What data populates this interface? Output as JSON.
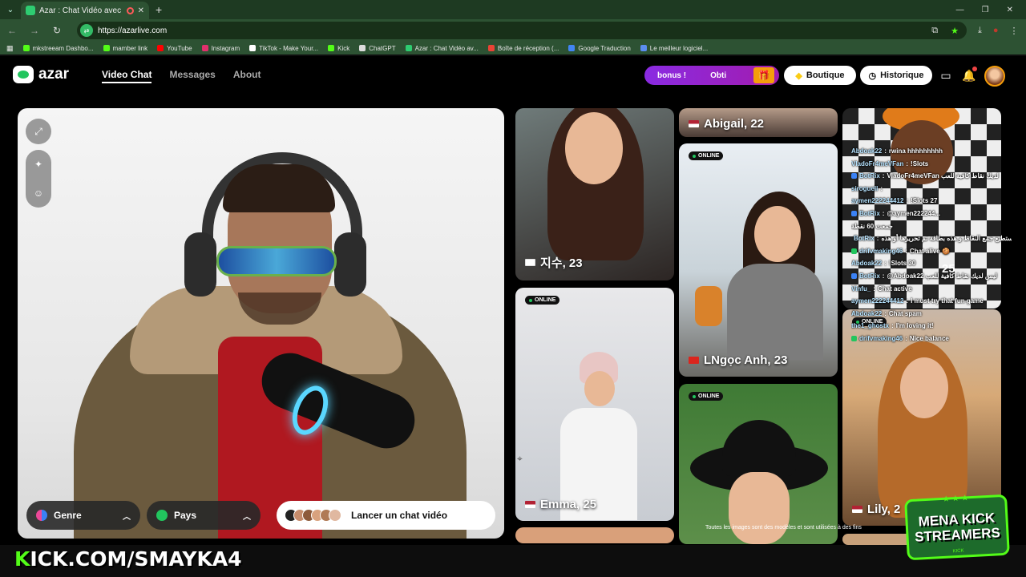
{
  "browser": {
    "tab_title": "Azar : Chat Vidéo avec de n",
    "url": "https://azarlive.com",
    "bookmarks": [
      {
        "label": "mkstreeam Dashbo...",
        "color": "#53fc18"
      },
      {
        "label": "mamber link",
        "color": "#53fc18"
      },
      {
        "label": "YouTube",
        "color": "#ff0000"
      },
      {
        "label": "Instagram",
        "color": "#e1306c"
      },
      {
        "label": "TikTok - Make Your...",
        "color": "#ffffff"
      },
      {
        "label": "Kick",
        "color": "#53fc18"
      },
      {
        "label": "ChatGPT",
        "color": "#dddddd"
      },
      {
        "label": "Azar : Chat Vidéo av...",
        "color": "#2ecc71"
      },
      {
        "label": "Boîte de réception (...",
        "color": "#ea4335"
      },
      {
        "label": "Google Traduction",
        "color": "#4285f4"
      },
      {
        "label": "Le meilleur logiciel...",
        "color": "#5b8def"
      }
    ]
  },
  "site": {
    "logo_text": "azar",
    "nav": [
      {
        "label": "Video Chat",
        "active": true
      },
      {
        "label": "Messages",
        "active": false
      },
      {
        "label": "About",
        "active": false
      }
    ],
    "promo": {
      "text_left": "bonus !",
      "text_right": "Obti"
    },
    "boutique_label": "Boutique",
    "historique_label": "Historique"
  },
  "video_panel": {
    "genre_label": "Genre",
    "pays_label": "Pays",
    "start_label": "Lancer un chat vidéo"
  },
  "cards": {
    "abigail": {
      "name": "Abigail, 22"
    },
    "jisu": {
      "name": "지수, 23"
    },
    "lngoc": {
      "name": "LNgọc Anh, 23",
      "status": "ONLINE"
    },
    "emma": {
      "name": "Emma, 25",
      "status": "ONLINE"
    },
    "col3_top_age": "25",
    "lily": {
      "name": "Lily, 2",
      "status": "ONLINE"
    },
    "col2_bottom_status": "ONLINE"
  },
  "chat": [
    {
      "user": "Abdoak22",
      "msg": "rwina hhhhhhhhh",
      "badge": ""
    },
    {
      "user": "VladoFr4meVFan",
      "msg": "!Slots",
      "badge": ""
    },
    {
      "user": "BotRix",
      "msg": "VladoFr4meVFan لديك نقاط كافية للعب",
      "badge": "#3b82f6"
    },
    {
      "user": "siroguell",
      "msg": "",
      "badge": ""
    },
    {
      "user": "aymen222244412",
      "msg": "!Slots 27",
      "badge": ""
    },
    {
      "user": "BotRix",
      "msg": "@aymen222244...",
      "badge": "#3b82f6"
    },
    {
      "user": "",
      "msg": "جمعت 60 نقطة",
      "badge": ""
    },
    {
      "user": "BotRix",
      "msg": "لا تستطيع جمع النقاط و هذه بطاقة تم تحريرها أو هذه",
      "badge": "#3b82f6"
    },
    {
      "user": "drifvmaking46",
      "msg": "Chat alive 🍪",
      "badge": "#22c55e"
    },
    {
      "user": "Abdoak22",
      "msg": "!Slots 30",
      "badge": ""
    },
    {
      "user": "BotRix",
      "msg": "@Abdoak22 ليس لديك نقاط كافية للعب",
      "badge": "#3b82f6"
    },
    {
      "user": "Vinfu_",
      "msg": "Chat active",
      "badge": ""
    },
    {
      "user": "aymen222244412",
      "msg": "I must try that fun game",
      "badge": ""
    },
    {
      "user": "Abdoak22",
      "msg": "Chat spam",
      "badge": ""
    },
    {
      "user": "the1_ghostx",
      "msg": "I'm loving it!",
      "badge": ""
    },
    {
      "user": "drifvmaking46",
      "msg": "Nice balance",
      "badge": "#22c55e"
    }
  ],
  "disclaimer": "Toutes les images sont des modèles et sont utilisées à des fins",
  "overlay": {
    "kick_channel": "ICK.COM/SMAYKA4",
    "kick_k": "K",
    "mena_line1": "MENA KICK",
    "mena_line2": "STREAMERS",
    "mena_small": "KICK"
  }
}
